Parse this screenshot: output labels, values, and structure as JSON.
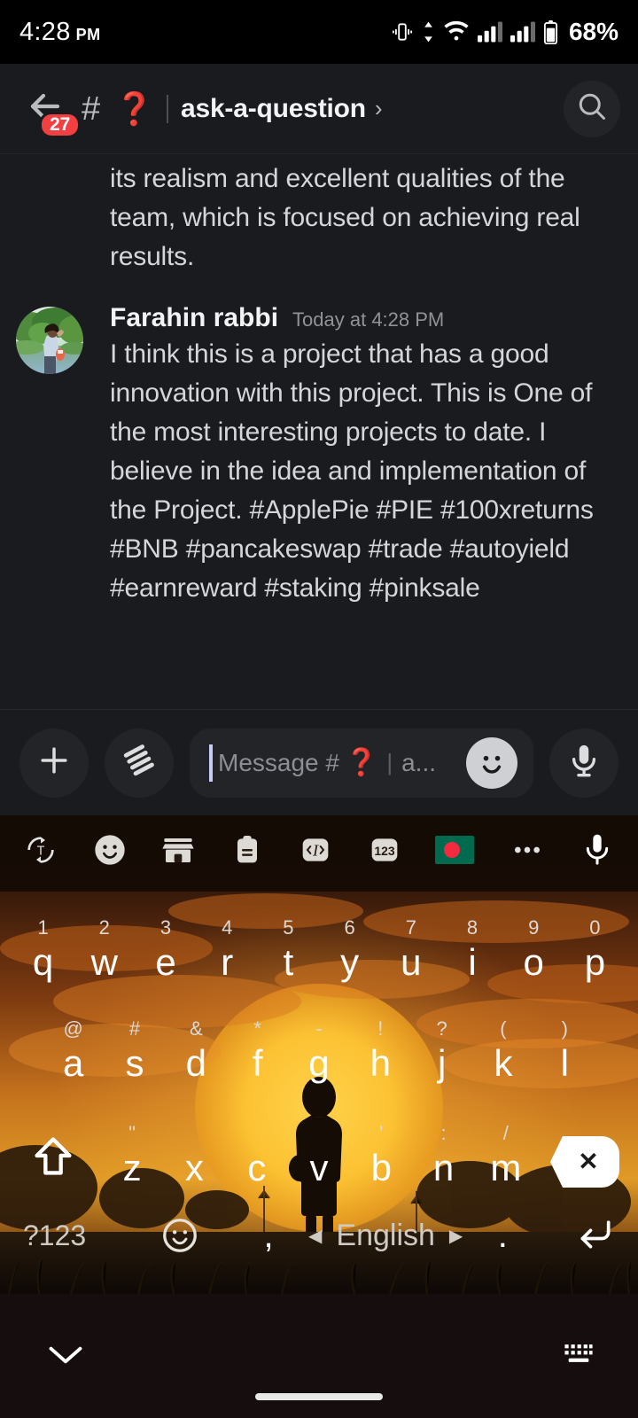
{
  "status_bar": {
    "time": "4:28",
    "ampm": "PM",
    "battery": "68%",
    "icons": [
      "vibrate-icon",
      "data-transfer-icon",
      "wifi-icon",
      "signal-sim1-icon",
      "signal-sim2-icon",
      "battery-icon"
    ]
  },
  "header": {
    "back_badge": "27",
    "hash": "#",
    "question_emoji": "❓",
    "divider": "|",
    "channel_name": "ask-a-question",
    "chevron": "›",
    "search_icon": "search-icon"
  },
  "messages": {
    "partial_message": {
      "text": "its realism and excellent qualities of the team, which is focused on achieving real results."
    },
    "message": {
      "author": "Farahin rabbi",
      "timestamp": "Today at 4:28 PM",
      "text": "I think this is a project that has a good innovation with this project. This is One of the most interesting projects to date. I believe in the idea and implementation of the Project. #ApplePie #PIE #100xreturns #BNB #pancakeswap #trade #autoyield #earnreward #staking #pinksale"
    }
  },
  "composer": {
    "add_label": "+",
    "gift_icon": "gift-icon",
    "placeholder_prefix": "Message #",
    "placeholder_emoji": "❓",
    "placeholder_divider": "|",
    "placeholder_suffix": "a...",
    "emoji_icon": "emoji-icon",
    "mic_icon": "microphone-icon"
  },
  "keyboard": {
    "toolbar": [
      "translate-icon",
      "emoji-icon",
      "store-icon",
      "clipboard-icon",
      "text-edit-icon",
      "numbers-icon",
      "bangladesh-flag-icon",
      "more-options-icon",
      "microphone-icon"
    ],
    "row1": [
      {
        "sub": "1",
        "main": "q"
      },
      {
        "sub": "2",
        "main": "w"
      },
      {
        "sub": "3",
        "main": "e"
      },
      {
        "sub": "4",
        "main": "r"
      },
      {
        "sub": "5",
        "main": "t"
      },
      {
        "sub": "6",
        "main": "y"
      },
      {
        "sub": "7",
        "main": "u"
      },
      {
        "sub": "8",
        "main": "i"
      },
      {
        "sub": "9",
        "main": "o"
      },
      {
        "sub": "0",
        "main": "p"
      }
    ],
    "row2": [
      {
        "sub": "@",
        "main": "a"
      },
      {
        "sub": "#",
        "main": "s"
      },
      {
        "sub": "&",
        "main": "d"
      },
      {
        "sub": "*",
        "main": "f"
      },
      {
        "sub": "-",
        "main": "g"
      },
      {
        "sub": "!",
        "main": "h"
      },
      {
        "sub": "?",
        "main": "j"
      },
      {
        "sub": "(",
        "main": "k"
      },
      {
        "sub": ")",
        "main": "l"
      }
    ],
    "row3": [
      {
        "sub": "\"",
        "main": "z"
      },
      {
        "sub": "",
        "main": "x"
      },
      {
        "sub": "",
        "main": "c"
      },
      {
        "sub": "",
        "main": "v"
      },
      {
        "sub": "'",
        "main": "b"
      },
      {
        "sub": ":",
        "main": "n"
      },
      {
        "sub": "/",
        "main": "m"
      }
    ],
    "shift_icon": "shift-icon",
    "backspace_icon": "backspace-icon",
    "backspace_glyph": "✕",
    "symbols_key": "?123",
    "emoji_key_icon": "emoji-icon",
    "comma_key": ",",
    "space_label": "English",
    "space_left_arrow": "◀",
    "space_right_arrow": "▶",
    "period_key": ".",
    "enter_icon": "enter-icon"
  },
  "nav_bar": {
    "down_icon": "chevron-down-icon",
    "keyboard_icon": "keyboard-toggle-icon",
    "home_pill": "home-indicator"
  },
  "colors": {
    "app_bg": "#1a1b1f",
    "badge_red": "#f23f42",
    "accent_red": "#f04747",
    "text_primary": "#f2f3f5",
    "text_body": "#d4d6da",
    "text_muted": "#8f9296",
    "keyboard_warm": "#c96a1e"
  }
}
